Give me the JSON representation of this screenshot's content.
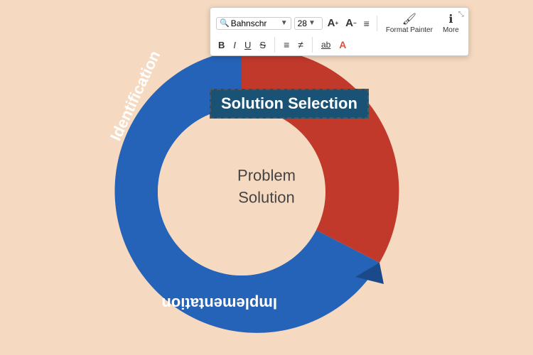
{
  "toolbar": {
    "font_name": "Bahnschr",
    "font_size": "28",
    "bold_label": "B",
    "italic_label": "I",
    "underline_label": "U",
    "strikethrough_label": "S",
    "bullet_list_label": "≡",
    "numbered_list_label": "≡",
    "underline_text_label": "ab",
    "caps_label": "A",
    "format_painter_label": "Format Painter",
    "more_label": "More"
  },
  "diagram": {
    "center_line1": "Problem",
    "center_line2": "Solution",
    "solution_selection": "Solution Selection",
    "identification": "Identification",
    "implementation": "Implementation"
  }
}
